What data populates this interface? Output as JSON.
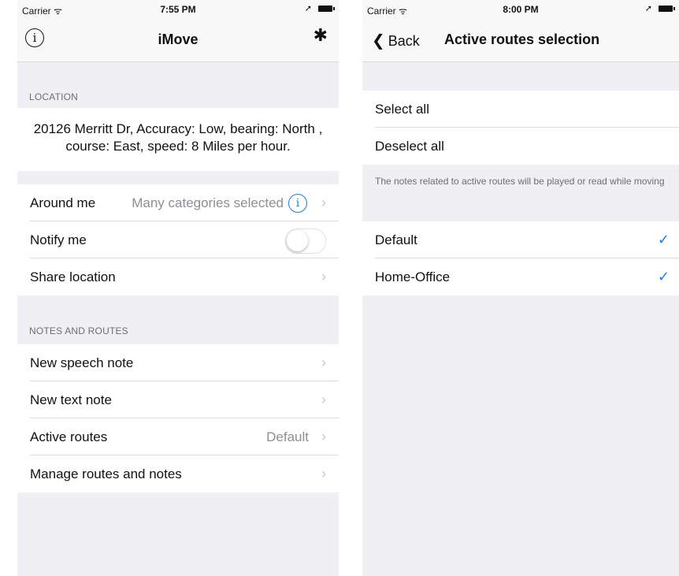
{
  "left": {
    "status": {
      "carrier": "Carrier ᯤ",
      "time": "7:55 PM"
    },
    "nav": {
      "title": "iMove",
      "info_glyph": "i"
    },
    "sections": {
      "location_header": "LOCATION",
      "location_text": "20126 Merritt Dr, Accuracy: Low, bearing: North , course: East, speed: 8 Miles per hour.",
      "notes_header": "NOTES AND ROUTES"
    },
    "rows": {
      "around_me": {
        "label": "Around me",
        "detail": "Many categories selected"
      },
      "notify_me": {
        "label": "Notify me",
        "toggle_on": false
      },
      "share_location": {
        "label": "Share location"
      },
      "new_speech_note": {
        "label": "New speech note"
      },
      "new_text_note": {
        "label": "New text note"
      },
      "active_routes": {
        "label": "Active routes",
        "detail": "Default"
      },
      "manage_routes": {
        "label": "Manage routes and notes"
      }
    }
  },
  "right": {
    "status": {
      "carrier": "Carrier ᯤ",
      "time": "8:00 PM"
    },
    "nav": {
      "back_label": "Back",
      "title": "Active routes selection"
    },
    "rows": {
      "select_all": "Select all",
      "deselect_all": "Deselect all",
      "note": "The notes related to active routes will be played or read while moving",
      "routes": [
        {
          "label": "Default",
          "checked": true
        },
        {
          "label": "Home-Office",
          "checked": true
        }
      ]
    }
  },
  "colors": {
    "accent": "#1f7ddb",
    "background": "#efeff4",
    "separator": "#dcdce0"
  },
  "icons": [
    "info-icon",
    "gear-icon",
    "chevron-left-icon",
    "chevron-right-icon",
    "checkmark-icon",
    "location-arrow-icon",
    "battery-icon"
  ]
}
